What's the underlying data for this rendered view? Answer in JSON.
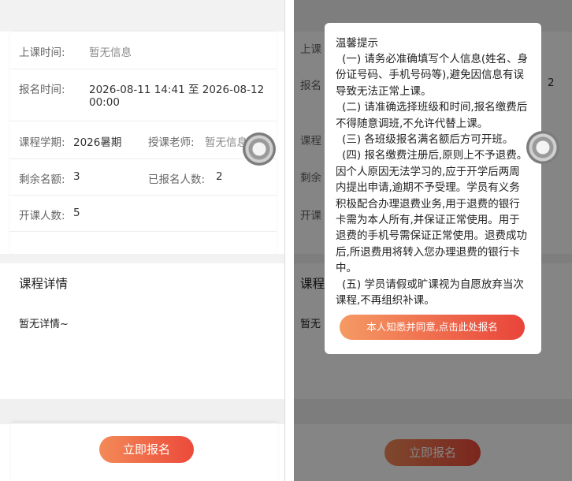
{
  "course_info": {
    "class_time_label": "上课时间:",
    "class_time_value": "暂无信息",
    "enroll_time_label": "报名时间:",
    "enroll_time_value_line1": "2026-08-11 14:41 至 2026-08-12",
    "enroll_time_value_line2": "00:00",
    "term_label": "课程学期:",
    "term_value": "2026暑期",
    "teacher_label": "授课老师:",
    "teacher_value": "暂无信息",
    "remaining_label": "剩余名额:",
    "remaining_value": "3",
    "enrolled_label": "已报名人数:",
    "enrolled_value": "2",
    "min_open_label": "开课人数:",
    "min_open_value": "5"
  },
  "details": {
    "title": "课程详情",
    "text": "暂无详情~"
  },
  "footer": {
    "apply_label": "立即报名"
  },
  "modal": {
    "title": "温馨提示",
    "terms": [
      "(一) 请务必准确填写个人信息(姓名、身份证号码、手机号码等),避免因信息有误导致无法正常上课。",
      "(二) 请准确选择班级和时间,报名缴费后不得随意调班,不允许代替上课。",
      "(三) 各班级报名满名额后方可开班。",
      "(四) 报名缴费注册后,原则上不予退费。因个人原因无法学习的,应于开学后两周内提出申请,逾期不予受理。学员有义务积极配合办理退费业务,用于退费的银行卡需为本人所有,并保证正常使用。用于退费的手机号需保证正常使用。退费成功后,所退费用将转入您办理退费的银行卡中。",
      "(五) 学员请假或旷课视为自愿放弃当次课程,不再组织补课。"
    ],
    "agree_label": "本人知悉并同意,点击此处报名"
  },
  "background_peek": {
    "class_time_fragment": "上课",
    "enroll_fragment": "报名",
    "enroll_tail_fragment": "2",
    "term_fragment": "课程",
    "remaining_fragment": "剩余",
    "open_fragment": "开课",
    "details_fragment": "课程",
    "details_text_fragment": "暂无"
  },
  "colors": {
    "button_gradient_start": "#f38a58",
    "button_gradient_end": "#ec4a3a",
    "overlay": "rgba(0,0,0,0.48)"
  }
}
